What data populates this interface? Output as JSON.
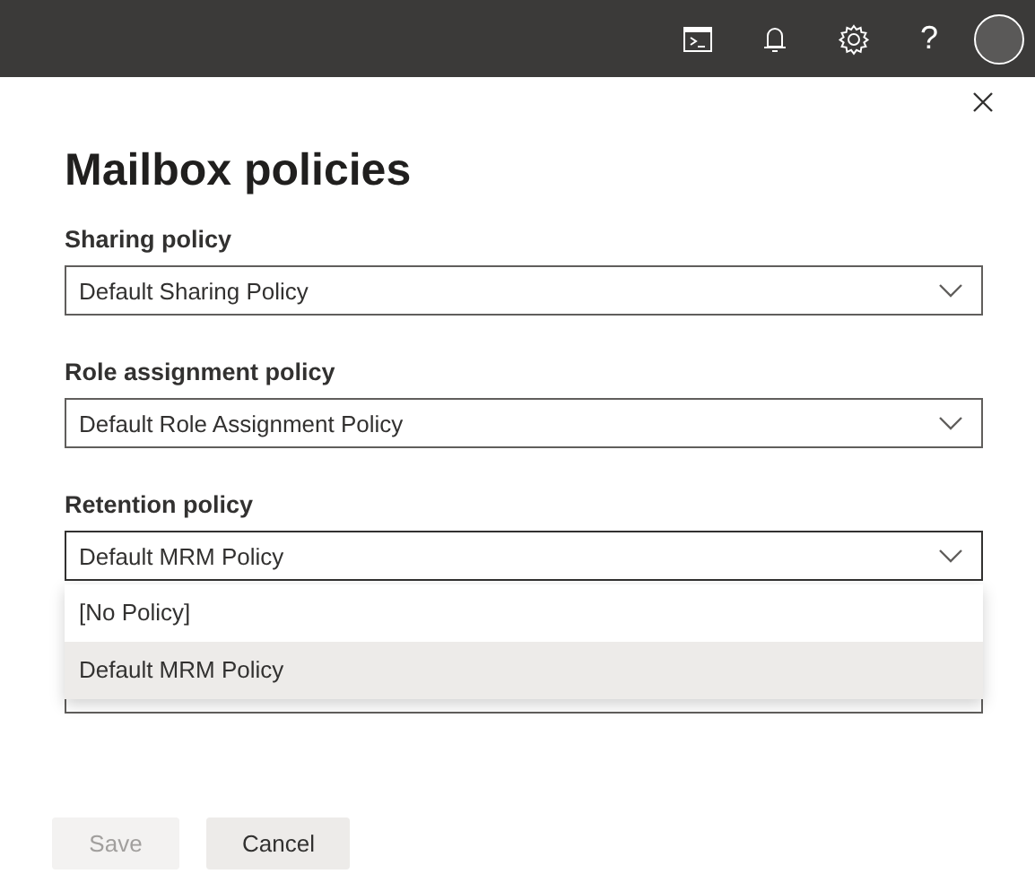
{
  "top_bar": {
    "help_glyph": "?"
  },
  "panel": {
    "title": "Mailbox policies"
  },
  "fields": [
    {
      "label": "Sharing policy",
      "value": "Default Sharing Policy",
      "expanded": false
    },
    {
      "label": "Role assignment policy",
      "value": "Default Role Assignment Policy",
      "expanded": false
    },
    {
      "label": "Retention policy",
      "value": "Default MRM Policy",
      "expanded": true,
      "options": [
        {
          "label": "[No Policy]",
          "selected": false
        },
        {
          "label": "Default MRM Policy",
          "selected": true
        }
      ]
    }
  ],
  "buttons": [
    {
      "label": "Save",
      "disabled": true
    },
    {
      "label": "Cancel",
      "disabled": false
    }
  ]
}
